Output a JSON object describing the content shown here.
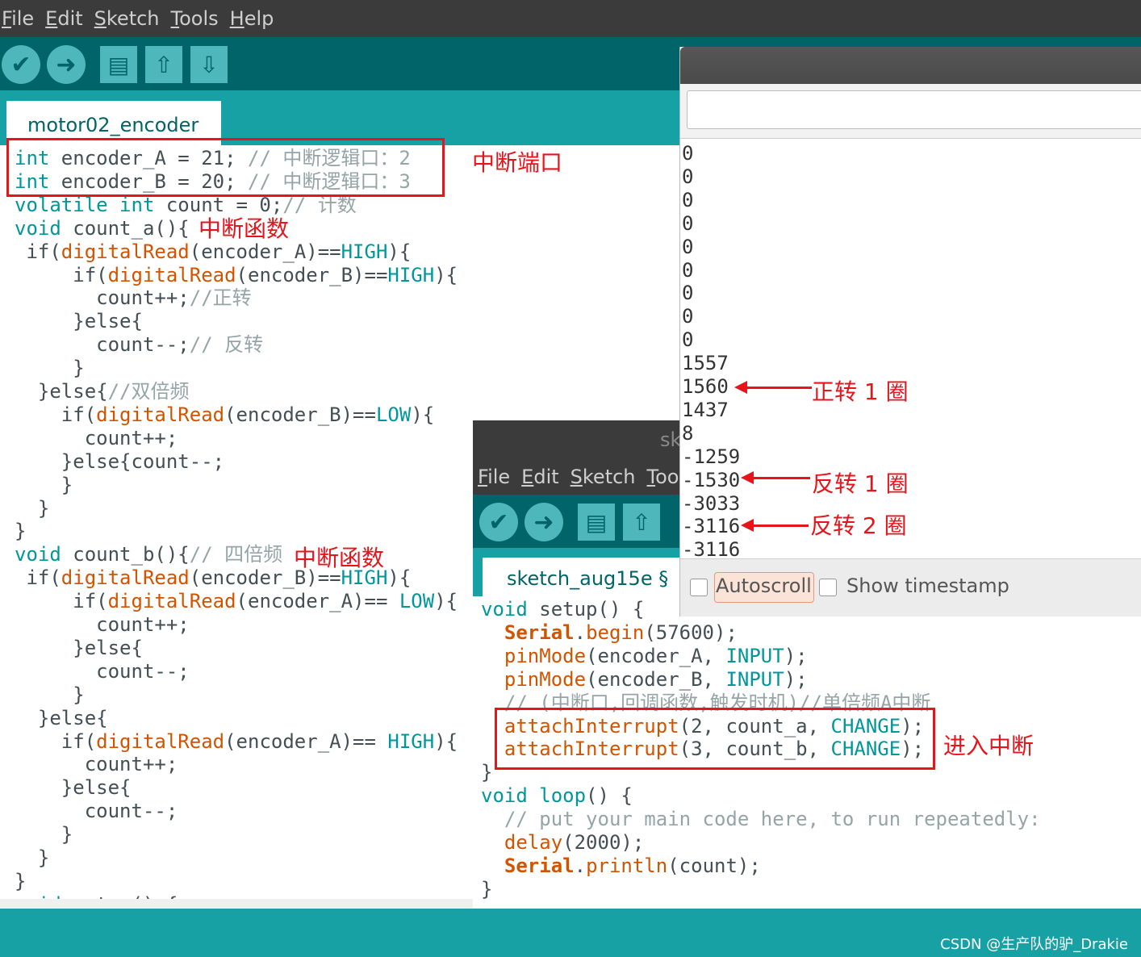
{
  "menu": [
    "File",
    "Edit",
    "Sketch",
    "Tools",
    "Help"
  ],
  "toolbar": {
    "verify_icon": "✔",
    "upload_icon": "➜",
    "new_icon": "▤",
    "open_icon": "⇧",
    "save_icon": "⇩"
  },
  "editor1": {
    "tab": "motor02_encoder",
    "lines": [
      {
        "segs": [
          {
            "t": "int",
            "c": "k"
          },
          {
            "t": " encoder_A = 21; ",
            "c": ""
          },
          {
            "t": "// 中断逻辑口：2",
            "c": "c"
          }
        ]
      },
      {
        "segs": [
          {
            "t": "int",
            "c": "k"
          },
          {
            "t": " encoder_B = 20; ",
            "c": ""
          },
          {
            "t": "// 中断逻辑口：3",
            "c": "c"
          }
        ]
      },
      {
        "segs": [
          {
            "t": "volatile int",
            "c": "k"
          },
          {
            "t": " count = 0;",
            "c": ""
          },
          {
            "t": "// 计数",
            "c": "c"
          }
        ]
      },
      {
        "segs": [
          {
            "t": "void",
            "c": "k"
          },
          {
            "t": " count_a(){",
            "c": ""
          }
        ]
      },
      {
        "segs": [
          {
            "t": " if(",
            "c": ""
          },
          {
            "t": "digitalRead",
            "c": "f"
          },
          {
            "t": "(encoder_A)==",
            "c": ""
          },
          {
            "t": "HIGH",
            "c": "k"
          },
          {
            "t": "){",
            "c": ""
          }
        ]
      },
      {
        "segs": [
          {
            "t": "     if(",
            "c": ""
          },
          {
            "t": "digitalRead",
            "c": "f"
          },
          {
            "t": "(encoder_B)==",
            "c": ""
          },
          {
            "t": "HIGH",
            "c": "k"
          },
          {
            "t": "){",
            "c": ""
          }
        ]
      },
      {
        "segs": [
          {
            "t": "       count++;",
            "c": ""
          },
          {
            "t": "//正转",
            "c": "c"
          }
        ]
      },
      {
        "segs": [
          {
            "t": "     }else{",
            "c": ""
          }
        ]
      },
      {
        "segs": [
          {
            "t": "       count--;",
            "c": ""
          },
          {
            "t": "// 反转",
            "c": "c"
          }
        ]
      },
      {
        "segs": [
          {
            "t": "     }",
            "c": ""
          }
        ]
      },
      {
        "segs": [
          {
            "t": "  }else{",
            "c": ""
          },
          {
            "t": "//双倍频",
            "c": "c"
          }
        ]
      },
      {
        "segs": [
          {
            "t": "    if(",
            "c": ""
          },
          {
            "t": "digitalRead",
            "c": "f"
          },
          {
            "t": "(encoder_B)==",
            "c": ""
          },
          {
            "t": "LOW",
            "c": "k"
          },
          {
            "t": "){",
            "c": ""
          }
        ]
      },
      {
        "segs": [
          {
            "t": "      count++;",
            "c": ""
          }
        ]
      },
      {
        "segs": [
          {
            "t": "    }else{count--;",
            "c": ""
          }
        ]
      },
      {
        "segs": [
          {
            "t": "    }",
            "c": ""
          }
        ]
      },
      {
        "segs": [
          {
            "t": "  }",
            "c": ""
          }
        ]
      },
      {
        "segs": [
          {
            "t": "}",
            "c": ""
          }
        ]
      },
      {
        "segs": [
          {
            "t": "void",
            "c": "k"
          },
          {
            "t": " count_b(){",
            "c": ""
          },
          {
            "t": "// 四倍频",
            "c": "c"
          }
        ]
      },
      {
        "segs": [
          {
            "t": " if(",
            "c": ""
          },
          {
            "t": "digitalRead",
            "c": "f"
          },
          {
            "t": "(encoder_B)==",
            "c": ""
          },
          {
            "t": "HIGH",
            "c": "k"
          },
          {
            "t": "){",
            "c": ""
          }
        ]
      },
      {
        "segs": [
          {
            "t": "     if(",
            "c": ""
          },
          {
            "t": "digitalRead",
            "c": "f"
          },
          {
            "t": "(encoder_A)== ",
            "c": ""
          },
          {
            "t": "LOW",
            "c": "k"
          },
          {
            "t": "){",
            "c": ""
          }
        ]
      },
      {
        "segs": [
          {
            "t": "       count++;",
            "c": ""
          }
        ]
      },
      {
        "segs": [
          {
            "t": "     }else{",
            "c": ""
          }
        ]
      },
      {
        "segs": [
          {
            "t": "       count--;",
            "c": ""
          }
        ]
      },
      {
        "segs": [
          {
            "t": "     }",
            "c": ""
          }
        ]
      },
      {
        "segs": [
          {
            "t": "  }else{",
            "c": ""
          }
        ]
      },
      {
        "segs": [
          {
            "t": "    if(",
            "c": ""
          },
          {
            "t": "digitalRead",
            "c": "f"
          },
          {
            "t": "(encoder_A)== ",
            "c": ""
          },
          {
            "t": "HIGH",
            "c": "k"
          },
          {
            "t": "){",
            "c": ""
          }
        ]
      },
      {
        "segs": [
          {
            "t": "      count++;",
            "c": ""
          }
        ]
      },
      {
        "segs": [
          {
            "t": "    }else{",
            "c": ""
          }
        ]
      },
      {
        "segs": [
          {
            "t": "      count--;",
            "c": ""
          }
        ]
      },
      {
        "segs": [
          {
            "t": "    }",
            "c": ""
          }
        ]
      },
      {
        "segs": [
          {
            "t": "  }",
            "c": ""
          }
        ]
      },
      {
        "segs": [
          {
            "t": "}",
            "c": ""
          }
        ]
      },
      {
        "segs": [
          {
            "t": "void",
            "c": "k"
          },
          {
            "t": " setup() {",
            "c": ""
          }
        ]
      }
    ]
  },
  "editor2": {
    "title_fragment": "sk",
    "menu": [
      "File",
      "Edit",
      "Sketch",
      "Too"
    ],
    "tab": "sketch_aug15e §",
    "lines": [
      {
        "segs": [
          {
            "t": "void",
            "c": "k"
          },
          {
            "t": " setup() {",
            "c": ""
          }
        ]
      },
      {
        "segs": [
          {
            "t": "  ",
            "c": ""
          },
          {
            "t": "Serial",
            "c": "fb"
          },
          {
            "t": ".",
            "c": ""
          },
          {
            "t": "begin",
            "c": "f"
          },
          {
            "t": "(57600);",
            "c": ""
          }
        ]
      },
      {
        "segs": [
          {
            "t": "  ",
            "c": ""
          },
          {
            "t": "pinMode",
            "c": "f"
          },
          {
            "t": "(encoder_A, ",
            "c": ""
          },
          {
            "t": "INPUT",
            "c": "k"
          },
          {
            "t": ");",
            "c": ""
          }
        ]
      },
      {
        "segs": [
          {
            "t": "  ",
            "c": ""
          },
          {
            "t": "pinMode",
            "c": "f"
          },
          {
            "t": "(encoder_B, ",
            "c": ""
          },
          {
            "t": "INPUT",
            "c": "k"
          },
          {
            "t": ");",
            "c": ""
          }
        ]
      },
      {
        "segs": [
          {
            "t": "  // (中断口,回调函数,触发时机)//单倍频A中断",
            "c": "c"
          }
        ]
      },
      {
        "segs": [
          {
            "t": "  ",
            "c": ""
          },
          {
            "t": "attachInterrupt",
            "c": "f"
          },
          {
            "t": "(2, count_a, ",
            "c": ""
          },
          {
            "t": "CHANGE",
            "c": "k"
          },
          {
            "t": ");",
            "c": ""
          }
        ]
      },
      {
        "segs": [
          {
            "t": "  ",
            "c": ""
          },
          {
            "t": "attachInterrupt",
            "c": "f"
          },
          {
            "t": "(3, count_b, ",
            "c": ""
          },
          {
            "t": "CHANGE",
            "c": "k"
          },
          {
            "t": ");",
            "c": ""
          }
        ]
      },
      {
        "segs": [
          {
            "t": "}",
            "c": ""
          }
        ]
      },
      {
        "segs": [
          {
            "t": "void",
            "c": "k"
          },
          {
            "t": " ",
            "c": ""
          },
          {
            "t": "loop",
            "c": "k"
          },
          {
            "t": "() {",
            "c": ""
          }
        ]
      },
      {
        "segs": [
          {
            "t": "  // put your main code here, to run repeatedly:",
            "c": "c"
          }
        ]
      },
      {
        "segs": [
          {
            "t": "  ",
            "c": ""
          },
          {
            "t": "delay",
            "c": "f"
          },
          {
            "t": "(2000);",
            "c": ""
          }
        ]
      },
      {
        "segs": [
          {
            "t": "  ",
            "c": ""
          },
          {
            "t": "Serial",
            "c": "fb"
          },
          {
            "t": ".",
            "c": ""
          },
          {
            "t": "println",
            "c": "f"
          },
          {
            "t": "(count);",
            "c": ""
          }
        ]
      },
      {
        "segs": [
          {
            "t": "}",
            "c": ""
          }
        ]
      }
    ]
  },
  "serial_monitor": {
    "input_value": "",
    "output": [
      "0",
      "0",
      "0",
      "0",
      "0",
      "0",
      "0",
      "0",
      "0",
      "1557",
      "1560",
      "1437",
      "8",
      "-1259",
      "-1530",
      "-3033",
      "-3116",
      "-3116"
    ],
    "autoscroll_label": "Autoscroll",
    "timestamp_label": "Show timestamp",
    "autoscroll_checked": false,
    "timestamp_checked": false
  },
  "annotations": {
    "interrupt_port": "中断端口",
    "isr_a": "中断函数",
    "isr_b": "中断函数",
    "forward_1": "正转 1 圈",
    "reverse_1": "反转 1 圈",
    "reverse_2": "反转 2 圈",
    "enter_interrupt": "进入中断"
  },
  "watermark": "CSDN @生产队的驴_Drakie",
  "colors": {
    "arduino_teal": "#006468",
    "arduino_tab_band": "#17a1a5",
    "keyword": "#00979c",
    "function": "#d35400",
    "comment": "#95a5a6",
    "annotation_red": "#e8141b"
  }
}
